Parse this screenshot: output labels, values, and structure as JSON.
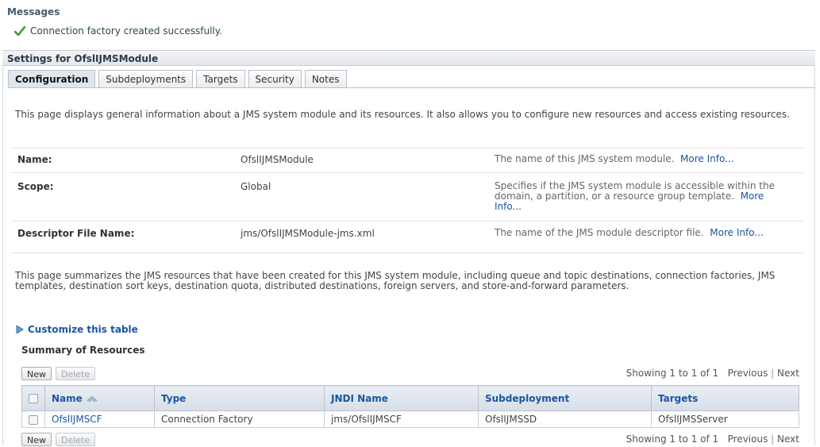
{
  "messages": {
    "title": "Messages",
    "success": "Connection factory created successfully."
  },
  "settings": {
    "title": "Settings for OfslIJMSModule"
  },
  "tabs": [
    {
      "label": "Configuration"
    },
    {
      "label": "Subdeployments"
    },
    {
      "label": "Targets"
    },
    {
      "label": "Security"
    },
    {
      "label": "Notes"
    }
  ],
  "intro": "This page displays general information about a JMS system module and its resources. It also allows you to configure new resources and access existing resources.",
  "fields": {
    "name": {
      "label": "Name:",
      "value": "OfslIJMSModule",
      "desc": "The name of this JMS system module.",
      "more": "More Info..."
    },
    "scope": {
      "label": "Scope:",
      "value": "Global",
      "desc": "Specifies if the JMS system module is accessible within the domain, a partition, or a resource group template.",
      "more": "More Info..."
    },
    "descriptor": {
      "label": "Descriptor File Name:",
      "value": "jms/OfslIJMSModule-jms.xml",
      "desc": "The name of the JMS module descriptor file.",
      "more": "More Info..."
    }
  },
  "summary_text": "This page summarizes the JMS resources that have been created for this JMS system module, including queue and topic destinations, connection factories, JMS templates, destination sort keys, destination quota, distributed destinations, foreign servers, and store-and-forward parameters.",
  "customize": "Customize this table",
  "table": {
    "title": "Summary of Resources",
    "new_label": "New",
    "delete_label": "Delete",
    "pager": {
      "showing": "Showing 1 to 1 of 1",
      "previous": "Previous",
      "next": "Next"
    },
    "headers": [
      "Name",
      "Type",
      "JNDI Name",
      "Subdeployment",
      "Targets"
    ],
    "rows": [
      {
        "name": "OfslIJMSCF",
        "type": "Connection Factory",
        "jndi": "jms/OfslIJMSCF",
        "subdeployment": "OfslIJMSSD",
        "targets": "OfslIJMSServer"
      }
    ]
  }
}
